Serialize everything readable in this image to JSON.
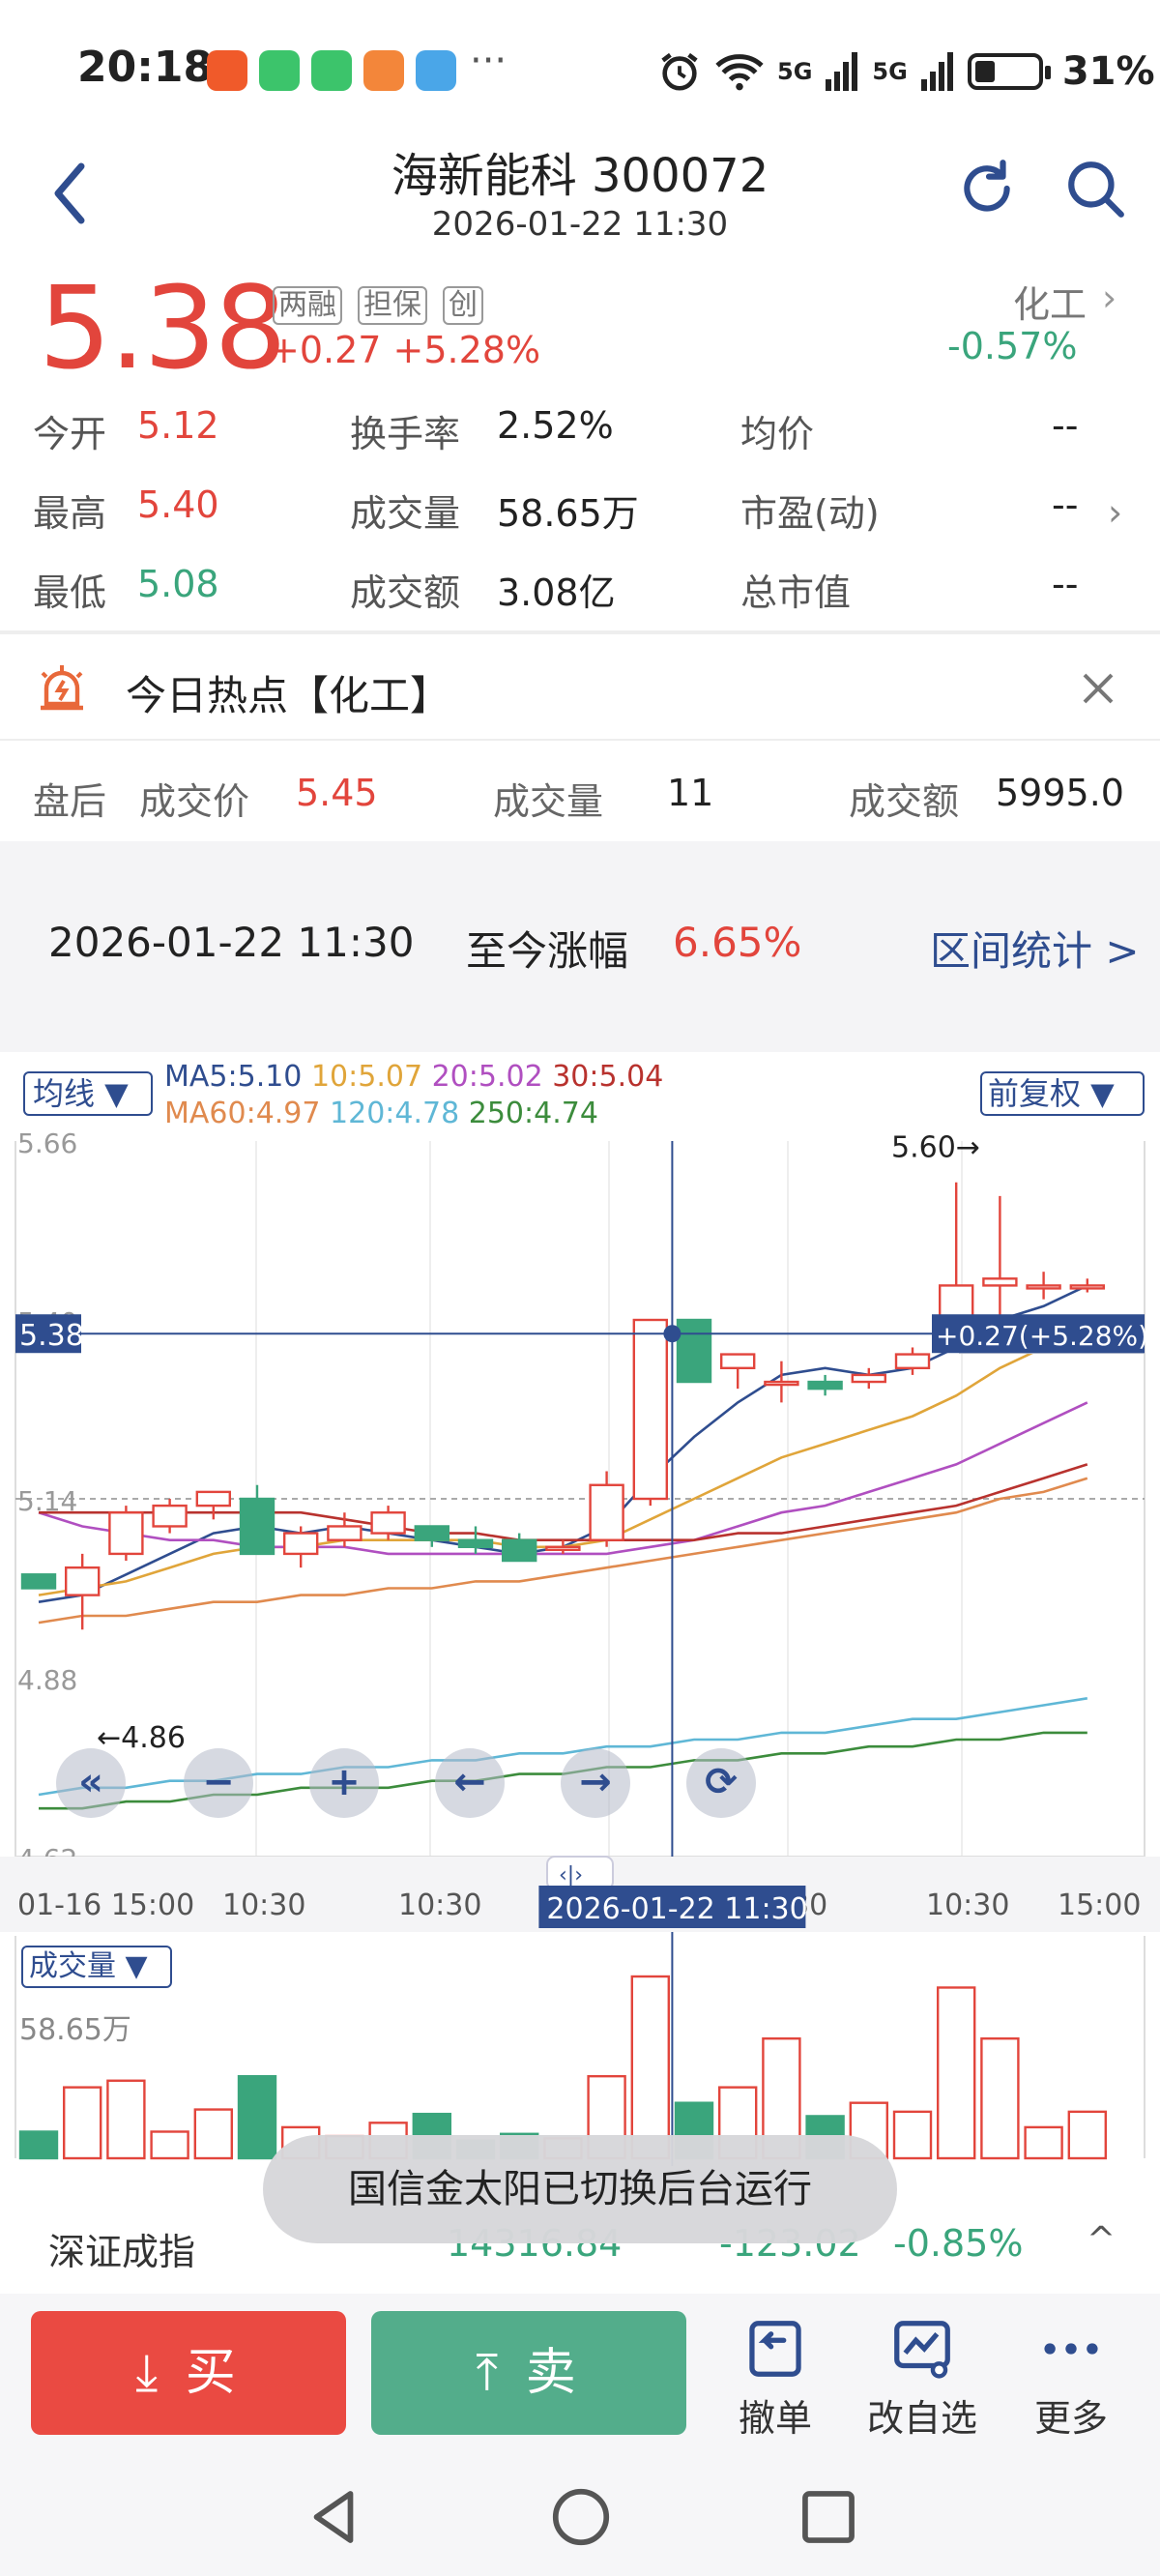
{
  "status": {
    "time": "20:18",
    "more": "···",
    "signal1": "5G",
    "signal2": "5G",
    "battery": "31%"
  },
  "header": {
    "title": "海新能科 300072",
    "time": "2026-01-22 11:30"
  },
  "quote": {
    "price": "5.38",
    "tags": [
      "两融",
      "担保",
      "创"
    ],
    "change": "+0.27 +5.28%",
    "sector": "化工",
    "sector_change": "-0.57%",
    "rows": [
      {
        "l1": "今开",
        "v1": "5.12",
        "l2": "换手率",
        "v2": "2.52%",
        "l3": "均价",
        "v3": "--"
      },
      {
        "l1": "最高",
        "v1": "5.40",
        "l2": "成交量",
        "v2": "58.65万",
        "l3": "市盈(动)",
        "v3": "--"
      },
      {
        "l1": "最低",
        "v1": "5.08",
        "l2": "成交额",
        "v2": "3.08亿",
        "l3": "总市值",
        "v3": "--"
      }
    ]
  },
  "hot": {
    "text": "今日热点【化工】"
  },
  "after_hours": {
    "label": "盘后",
    "price_label": "成交价",
    "price": "5.45",
    "vol_label": "成交量",
    "vol": "11",
    "amt_label": "成交额",
    "amt": "5995.0"
  },
  "range": {
    "time": "2026-01-22 11:30",
    "label": "至今涨幅",
    "value": "6.65%",
    "link": "区间统计 >"
  },
  "chart_controls": {
    "ma_select": "均线 ▼",
    "adjust_select": "前复权 ▼",
    "ma_line1": [
      {
        "text": "MA5:5.10",
        "color": "#2f4d8f"
      },
      {
        "text": "10:5.07",
        "color": "#e0a53a"
      },
      {
        "text": "20:5.02",
        "color": "#b04fc0"
      },
      {
        "text": "30:5.04",
        "color": "#b8322e"
      }
    ],
    "ma_line2": [
      {
        "text": "MA60:4.97",
        "color": "#2f4d8f"
      },
      {
        "text": "120:4.78",
        "color": "#5fb7d6"
      },
      {
        "text": "250:4.74",
        "color": "#3c8c3c"
      }
    ],
    "buttons": [
      "«",
      "−",
      "+",
      "←",
      "→",
      "⟳"
    ],
    "vol_select": "成交量 ▼",
    "vol_max": "58.65万"
  },
  "chart_data": {
    "type": "candlestick",
    "y_ticks": [
      "5.66",
      "5.40",
      "5.14",
      "4.88",
      "4.62"
    ],
    "ylim": [
      4.62,
      5.66
    ],
    "x_labels": [
      "01-16 15:00",
      "10:30",
      "10:30",
      "30",
      "10:30",
      "15:00"
    ],
    "crosshair": {
      "time": "2026-01-22 11:30",
      "price_label": "5.38",
      "change_label": "+0.27(+5.28%)",
      "price": 5.38,
      "index": 14.5
    },
    "annotations": [
      {
        "text": "5.60→",
        "price": 5.6
      },
      {
        "text": "←4.86",
        "price": 4.86
      }
    ],
    "candles": [
      {
        "o": 5.03,
        "h": 5.03,
        "l": 5.01,
        "c": 5.01
      },
      {
        "o": 5.0,
        "h": 5.06,
        "l": 4.95,
        "c": 5.04
      },
      {
        "o": 5.06,
        "h": 5.13,
        "l": 5.05,
        "c": 5.12
      },
      {
        "o": 5.1,
        "h": 5.14,
        "l": 5.09,
        "c": 5.13
      },
      {
        "o": 5.13,
        "h": 5.15,
        "l": 5.11,
        "c": 5.15
      },
      {
        "o": 5.14,
        "h": 5.16,
        "l": 5.06,
        "c": 5.06
      },
      {
        "o": 5.06,
        "h": 5.1,
        "l": 5.04,
        "c": 5.09
      },
      {
        "o": 5.08,
        "h": 5.12,
        "l": 5.07,
        "c": 5.1
      },
      {
        "o": 5.09,
        "h": 5.13,
        "l": 5.08,
        "c": 5.12
      },
      {
        "o": 5.1,
        "h": 5.1,
        "l": 5.07,
        "c": 5.08
      },
      {
        "o": 5.08,
        "h": 5.1,
        "l": 5.06,
        "c": 5.07
      },
      {
        "o": 5.08,
        "h": 5.09,
        "l": 5.05,
        "c": 5.05
      },
      {
        "o": 5.07,
        "h": 5.08,
        "l": 5.06,
        "c": 5.07
      },
      {
        "o": 5.08,
        "h": 5.18,
        "l": 5.07,
        "c": 5.16
      },
      {
        "o": 5.14,
        "h": 5.4,
        "l": 5.13,
        "c": 5.4
      },
      {
        "o": 5.4,
        "h": 5.4,
        "l": 5.31,
        "c": 5.31
      },
      {
        "o": 5.33,
        "h": 5.35,
        "l": 5.3,
        "c": 5.35
      },
      {
        "o": 5.31,
        "h": 5.34,
        "l": 5.28,
        "c": 5.31
      },
      {
        "o": 5.31,
        "h": 5.32,
        "l": 5.29,
        "c": 5.3
      },
      {
        "o": 5.31,
        "h": 5.33,
        "l": 5.3,
        "c": 5.32
      },
      {
        "o": 5.33,
        "h": 5.36,
        "l": 5.32,
        "c": 5.35
      },
      {
        "o": 5.38,
        "h": 5.6,
        "l": 5.36,
        "c": 5.45
      },
      {
        "o": 5.45,
        "h": 5.58,
        "l": 5.4,
        "c": 5.46
      },
      {
        "o": 5.45,
        "h": 5.47,
        "l": 5.43,
        "c": 5.45
      },
      {
        "o": 5.45,
        "h": 5.46,
        "l": 5.44,
        "c": 5.45
      }
    ],
    "series": [
      {
        "color": "#2f4d8f",
        "values": [
          4.99,
          5.0,
          5.03,
          5.06,
          5.09,
          5.1,
          5.09,
          5.1,
          5.09,
          5.08,
          5.07,
          5.06,
          5.07,
          5.1,
          5.17,
          5.23,
          5.28,
          5.32,
          5.33,
          5.32,
          5.33,
          5.36,
          5.4,
          5.42,
          5.45
        ]
      },
      {
        "color": "#e0a53a",
        "values": [
          5.0,
          5.01,
          5.02,
          5.04,
          5.06,
          5.07,
          5.07,
          5.08,
          5.08,
          5.08,
          5.08,
          5.07,
          5.07,
          5.08,
          5.11,
          5.14,
          5.17,
          5.2,
          5.22,
          5.24,
          5.26,
          5.29,
          5.33,
          5.36,
          5.38
        ]
      },
      {
        "color": "#b04fc0",
        "values": [
          5.12,
          5.1,
          5.09,
          5.08,
          5.08,
          5.07,
          5.07,
          5.07,
          5.06,
          5.06,
          5.06,
          5.06,
          5.06,
          5.06,
          5.07,
          5.08,
          5.1,
          5.12,
          5.13,
          5.15,
          5.17,
          5.19,
          5.22,
          5.25,
          5.28
        ]
      },
      {
        "color": "#b8322e",
        "values": [
          5.12,
          5.12,
          5.12,
          5.12,
          5.12,
          5.12,
          5.12,
          5.11,
          5.1,
          5.09,
          5.09,
          5.08,
          5.08,
          5.08,
          5.08,
          5.08,
          5.09,
          5.09,
          5.1,
          5.11,
          5.12,
          5.13,
          5.15,
          5.17,
          5.19
        ]
      },
      {
        "color": "#e08a4e",
        "values": [
          4.96,
          4.97,
          4.97,
          4.98,
          4.99,
          4.99,
          5.0,
          5.0,
          5.01,
          5.01,
          5.02,
          5.02,
          5.03,
          5.04,
          5.05,
          5.06,
          5.07,
          5.08,
          5.09,
          5.1,
          5.11,
          5.12,
          5.14,
          5.15,
          5.17
        ]
      },
      {
        "color": "#5fb7d6",
        "values": [
          4.71,
          4.72,
          4.72,
          4.73,
          4.73,
          4.74,
          4.74,
          4.75,
          4.75,
          4.76,
          4.76,
          4.77,
          4.77,
          4.78,
          4.78,
          4.79,
          4.79,
          4.8,
          4.8,
          4.81,
          4.82,
          4.82,
          4.83,
          4.84,
          4.85
        ]
      },
      {
        "color": "#3c8c3c",
        "values": [
          4.69,
          4.69,
          4.7,
          4.7,
          4.71,
          4.71,
          4.72,
          4.72,
          4.72,
          4.73,
          4.73,
          4.74,
          4.74,
          4.75,
          4.75,
          4.76,
          4.76,
          4.77,
          4.77,
          4.78,
          4.78,
          4.79,
          4.79,
          4.8,
          4.8
        ]
      }
    ],
    "volume": [
      0.12,
      0.32,
      0.35,
      0.12,
      0.22,
      0.37,
      0.14,
      0.1,
      0.16,
      0.2,
      0.08,
      0.11,
      0.09,
      0.37,
      0.82,
      0.25,
      0.32,
      0.54,
      0.19,
      0.25,
      0.21,
      0.77,
      0.54,
      0.14,
      0.21
    ],
    "vol_max": 58.65
  },
  "index": {
    "name": "深证成指",
    "value": "14316.84",
    "change": "-123.02",
    "pct": "-0.85%",
    "caret": "^"
  },
  "toast": "国信金太阳已切换后台运行",
  "bottom": {
    "buy": "买",
    "sell": "卖",
    "cancel": "撤单",
    "watchlist": "改自选",
    "more": "更多"
  }
}
